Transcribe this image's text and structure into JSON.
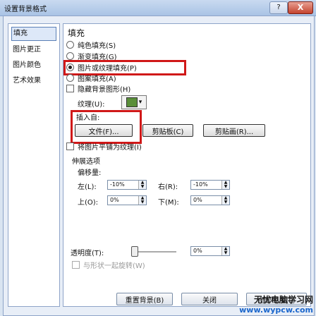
{
  "window": {
    "title": "设置背景格式",
    "help_label": "?",
    "close_label": "X"
  },
  "nav": {
    "items": [
      {
        "label": "填充",
        "selected": true
      },
      {
        "label": "图片更正",
        "selected": false
      },
      {
        "label": "图片颜色",
        "selected": false
      },
      {
        "label": "艺术效果",
        "selected": false
      }
    ]
  },
  "fill": {
    "section_title": "填充",
    "options": [
      {
        "label": "纯色填充(S)",
        "checked": false
      },
      {
        "label": "渐变填充(G)",
        "checked": false
      },
      {
        "label": "图片或纹理填充(P)",
        "checked": true
      },
      {
        "label": "图案填充(A)",
        "checked": false
      }
    ],
    "hide_background_label": "隐藏背景图形(H)",
    "texture_label": "纹理(U):",
    "texture_dropdown_arrow": "▾",
    "insert_from_label": "插入自:",
    "file_button": "文件(F)...",
    "clipboard_button": "剪贴板(C)",
    "clipart_button": "剪贴画(R)...",
    "tile_label": "将图片平铺为纹理(I)",
    "stretch_label": "伸展选项",
    "offset_label": "偏移量:",
    "left_label": "左(L):",
    "left_value": "-10%",
    "right_label": "右(R):",
    "right_value": "-10%",
    "top_label": "上(O):",
    "top_value": "0%",
    "bottom_label": "下(M):",
    "bottom_value": "0%",
    "transparency_label": "透明度(T):",
    "transparency_value": "0%",
    "rotate_with_shape_label": "与形状一起旋转(W)"
  },
  "footer": {
    "reset_button": "重置背景(B)",
    "close_button": "关闭",
    "apply_all_button": "全部应用(L)"
  },
  "watermark": {
    "line1": "无忧电脑学习网",
    "line2": "www.wypcw.com"
  },
  "colors": {
    "highlight_red": "#d01818",
    "accent_blue": "#1a66cc"
  }
}
